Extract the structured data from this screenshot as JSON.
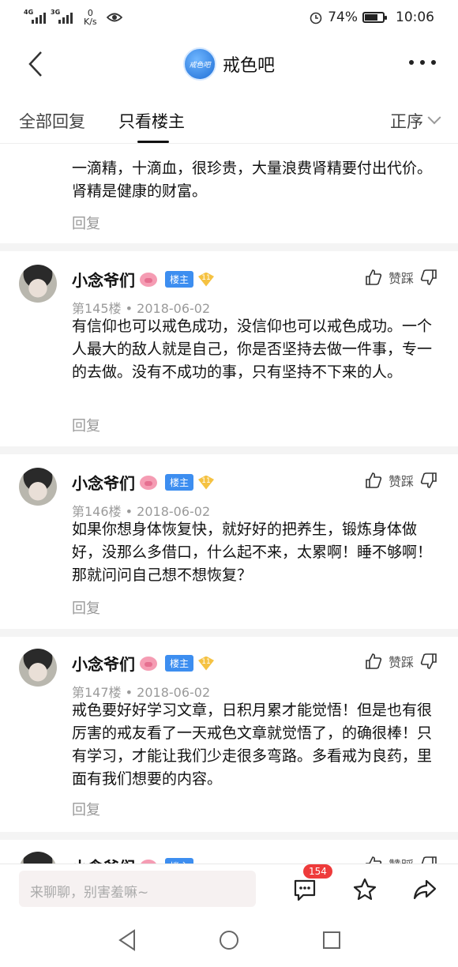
{
  "status": {
    "net1": "4G",
    "net2": "3G",
    "speed_value": "0",
    "speed_unit": "K/s",
    "battery": "74%",
    "time": "10:06",
    "battery_level": 0.74,
    "icons": [
      "signal-icon",
      "eye-icon",
      "alarm-icon",
      "battery-icon"
    ]
  },
  "header": {
    "forum_logo_text": "戒色吧",
    "forum_name": "戒色吧"
  },
  "tabs": {
    "all": "全部回复",
    "op_only": "只看楼主",
    "sort": "正序"
  },
  "partial_post": {
    "text": "一滴精，十滴血，很珍贵，大量浪费肾精要付出代价。肾精是健康的财富。",
    "reply": "回复"
  },
  "posts": [
    {
      "username": "小念爷们",
      "badge": "楼主",
      "level": "11",
      "floor": "第145楼",
      "date": "2018-06-02",
      "likes_label": "赞踩",
      "text": "有信仰也可以戒色成功，没信仰也可以戒色成功。一个人最大的敌人就是自己，你是否坚持去做一件事，专一的去做。没有不成功的事，只有坚持不下来的人。",
      "reply": "回复"
    },
    {
      "username": "小念爷们",
      "badge": "楼主",
      "level": "11",
      "floor": "第146楼",
      "date": "2018-06-02",
      "likes_label": "赞踩",
      "text": "如果你想身体恢复快，就好好的把养生，锻炼身体做好，没那么多借口，什么起不来，太累啊！睡不够啊！那就问问自己想不想恢复？",
      "reply": "回复"
    },
    {
      "username": "小念爷们",
      "badge": "楼主",
      "level": "11",
      "floor": "第147楼",
      "date": "2018-06-02",
      "likes_label": "赞踩",
      "text": "戒色要好好学习文章，日积月累才能觉悟！但是也有很厉害的戒友看了一天戒色文章就觉悟了，的确很棒！只有学习，才能让我们少走很多弯路。多看戒为良药，里面有我们想要的内容。",
      "reply": "回复"
    },
    {
      "username": "小念爷们",
      "badge": "楼主",
      "likes_label": "赞踩"
    }
  ],
  "bottom": {
    "placeholder": "来聊聊，别害羞嘛~",
    "comment_count": "154"
  }
}
